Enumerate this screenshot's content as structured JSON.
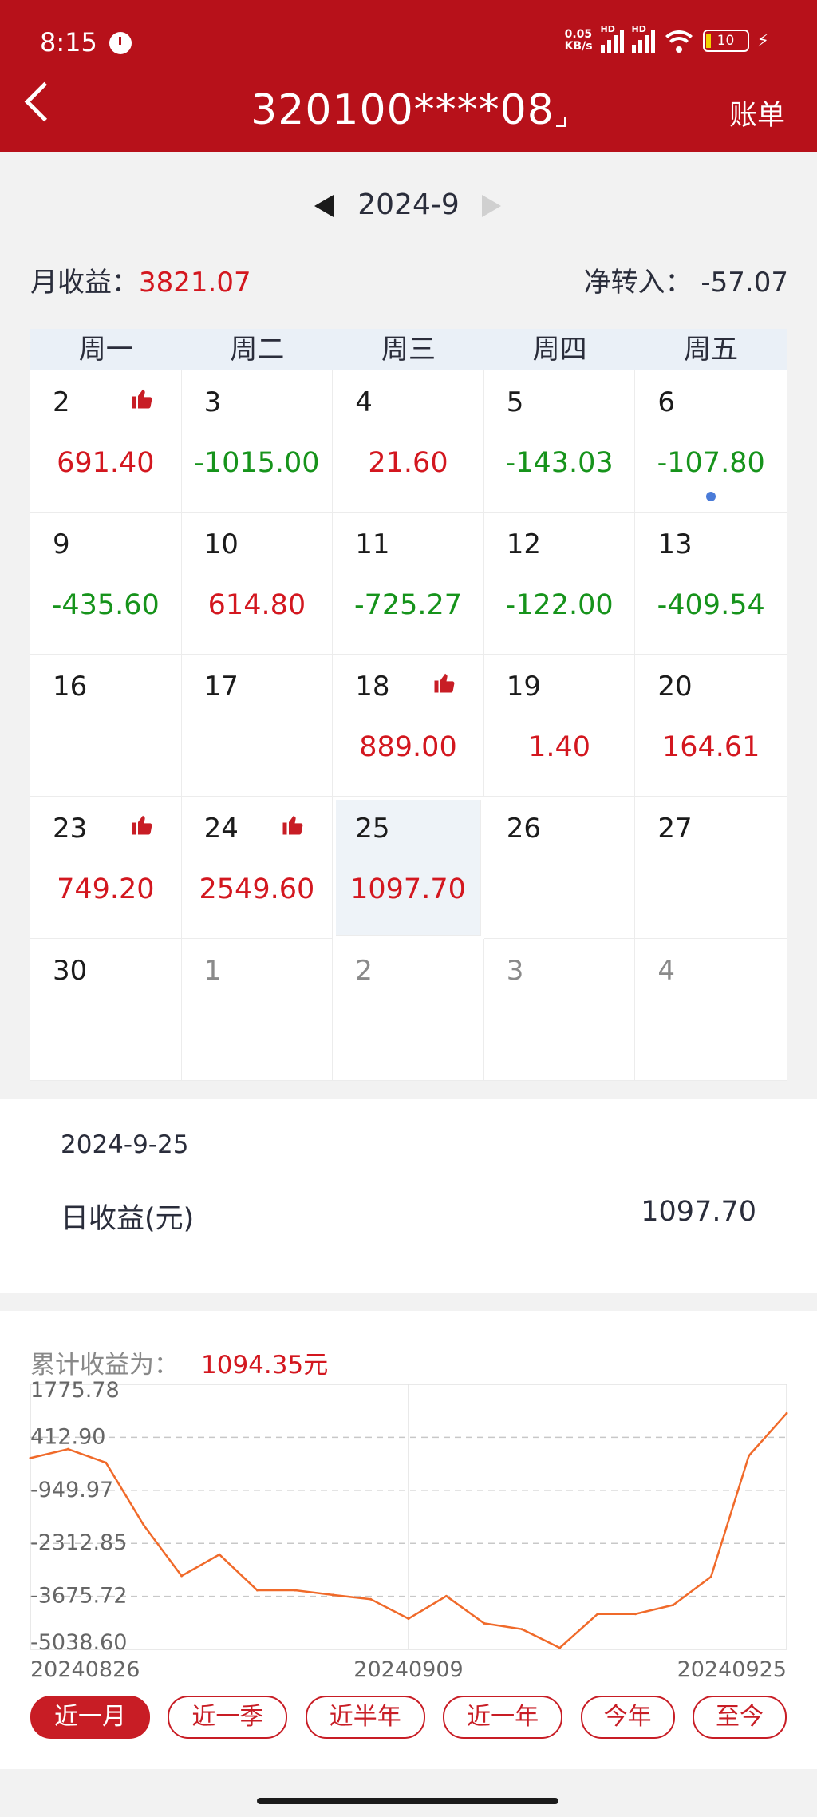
{
  "status_bar": {
    "time": "8:15",
    "net_speed_value": "0.05",
    "net_speed_unit": "KB/s",
    "signal_tag": "HD",
    "battery": "10"
  },
  "header": {
    "title": "320100****08",
    "right_action": "账单"
  },
  "month_nav": {
    "month": "2024-9"
  },
  "summary": {
    "monthly_income_label": "月收益：",
    "monthly_income_value": "3821.07",
    "net_transfer_label": "净转入：",
    "net_transfer_value": "-57.07"
  },
  "calendar": {
    "weekdays": [
      "周一",
      "周二",
      "周三",
      "周四",
      "周五"
    ],
    "cells": [
      {
        "day": "2",
        "amount": "691.40",
        "sign": "pos",
        "thumb": true
      },
      {
        "day": "3",
        "amount": "-1015.00",
        "sign": "neg"
      },
      {
        "day": "4",
        "amount": "21.60",
        "sign": "pos"
      },
      {
        "day": "5",
        "amount": "-143.03",
        "sign": "neg"
      },
      {
        "day": "6",
        "amount": "-107.80",
        "sign": "neg",
        "dot": true
      },
      {
        "day": "9",
        "amount": "-435.60",
        "sign": "neg"
      },
      {
        "day": "10",
        "amount": "614.80",
        "sign": "pos"
      },
      {
        "day": "11",
        "amount": "-725.27",
        "sign": "neg"
      },
      {
        "day": "12",
        "amount": "-122.00",
        "sign": "neg"
      },
      {
        "day": "13",
        "amount": "-409.54",
        "sign": "neg"
      },
      {
        "day": "16",
        "amount": ""
      },
      {
        "day": "17",
        "amount": ""
      },
      {
        "day": "18",
        "amount": "889.00",
        "sign": "pos",
        "thumb": true
      },
      {
        "day": "19",
        "amount": "1.40",
        "sign": "pos"
      },
      {
        "day": "20",
        "amount": "164.61",
        "sign": "pos"
      },
      {
        "day": "23",
        "amount": "749.20",
        "sign": "pos",
        "thumb": true
      },
      {
        "day": "24",
        "amount": "2549.60",
        "sign": "pos",
        "thumb": true
      },
      {
        "day": "25",
        "amount": "1097.70",
        "sign": "pos",
        "selected": true
      },
      {
        "day": "26",
        "amount": ""
      },
      {
        "day": "27",
        "amount": ""
      },
      {
        "day": "30",
        "amount": ""
      },
      {
        "day": "1",
        "amount": "",
        "muted": true
      },
      {
        "day": "2",
        "amount": "",
        "muted": true
      },
      {
        "day": "3",
        "amount": "",
        "muted": true
      },
      {
        "day": "4",
        "amount": "",
        "muted": true
      }
    ]
  },
  "detail": {
    "date": "2024-9-25",
    "label": "日收益(元)",
    "value": "1097.70"
  },
  "chart_section": {
    "cumulative_label": "累计收益为：",
    "cumulative_value": "1094.35元",
    "ranges": [
      "近一月",
      "近一季",
      "近半年",
      "近一年",
      "今年",
      "至今"
    ],
    "active_range": 0
  },
  "colors": {
    "brand_red": "#b7111a",
    "positive": "#d3171f",
    "negative": "#16931b",
    "line": "#f06a2a"
  },
  "chart_data": {
    "type": "line",
    "title": "",
    "xlabel": "",
    "ylabel": "",
    "y_ticks": [
      "1775.78",
      "412.90",
      "-949.97",
      "-2312.85",
      "-3675.72",
      "-5038.60"
    ],
    "y_tick_values": [
      1775.78,
      412.9,
      -949.97,
      -2312.85,
      -3675.72,
      -5038.6
    ],
    "ylim": [
      -5038.6,
      1775.78
    ],
    "x_tick_labels": [
      "20240826",
      "20240909",
      "20240925"
    ],
    "x_tick_index": [
      0,
      10,
      20
    ],
    "grid": true,
    "series": [
      {
        "values": [
          -120,
          110,
          -240,
          -1850,
          -3150,
          -2600,
          -3520,
          -3520,
          -3640,
          -3750,
          -4250,
          -3670,
          -4370,
          -4520,
          -5000,
          -4130,
          -4130,
          -3900,
          -3170,
          -60,
          1030
        ]
      }
    ]
  }
}
